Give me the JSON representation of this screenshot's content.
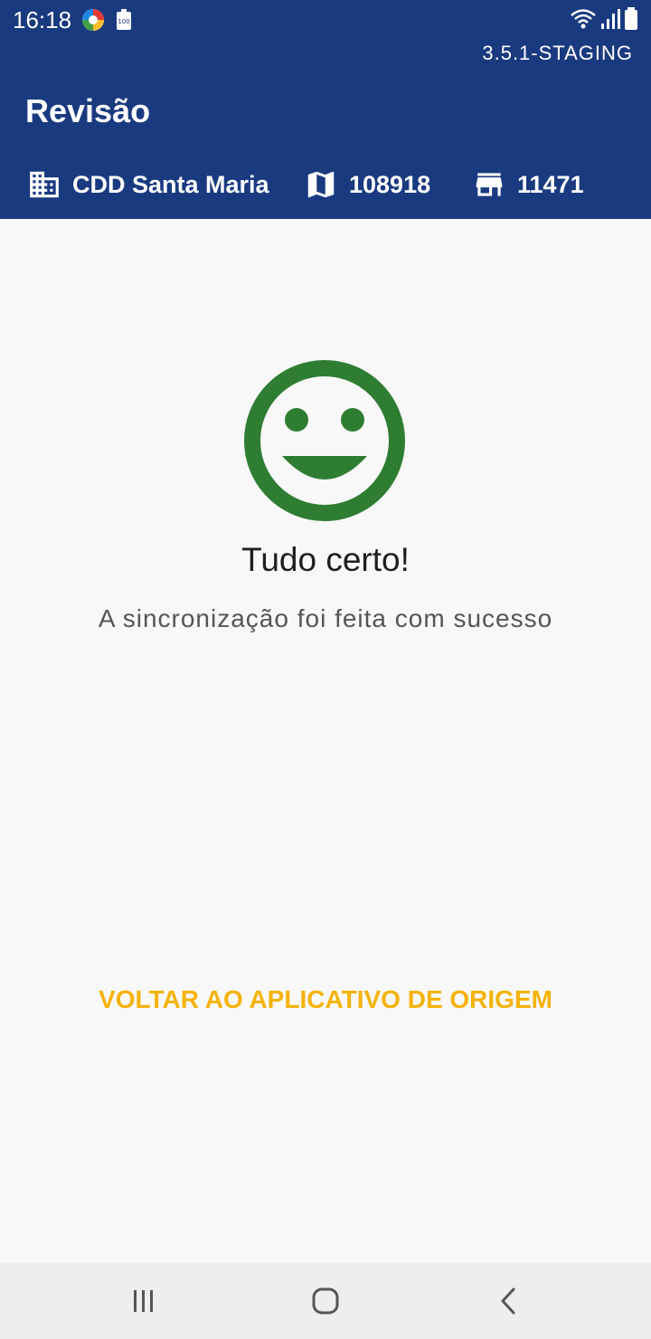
{
  "status_bar": {
    "time": "16:18",
    "battery_small_label": "100",
    "icons": [
      "app-icon",
      "battery-small-icon",
      "wifi-icon",
      "signal-icon",
      "battery-icon"
    ]
  },
  "header": {
    "version": "3.5.1-STAGING",
    "title": "Revisão",
    "background_color": "#1a3a80",
    "info": {
      "cdd": {
        "icon": "building-icon",
        "label": "CDD Santa Maria"
      },
      "map": {
        "icon": "map-icon",
        "label": "108918"
      },
      "store": {
        "icon": "store-icon",
        "label": "11471"
      }
    }
  },
  "result": {
    "icon": "smiley-icon",
    "icon_color": "#2e7d32",
    "title": "Tudo certo!",
    "message": "A sincronização foi feita com sucesso"
  },
  "actions": {
    "back_to_origin_label": "VOLTAR AO APLICATIVO DE ORIGEM",
    "accent_color": "#f5b30a"
  },
  "nav_bar": {
    "icons": [
      "recent-apps-icon",
      "home-icon",
      "back-icon"
    ]
  }
}
